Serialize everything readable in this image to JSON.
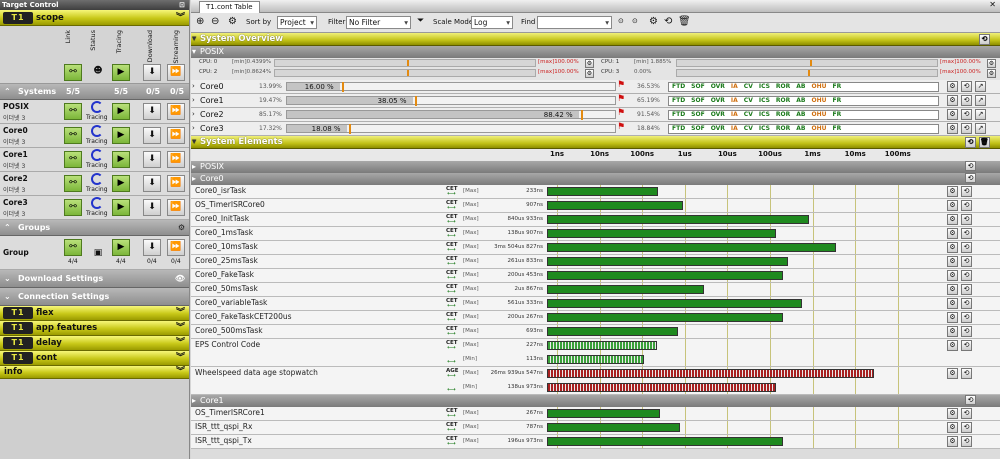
{
  "left": {
    "title": "Target Control",
    "scope_label": "scope",
    "logo_text": "T1",
    "col_headers": [
      "Link",
      "Status",
      "Tracing",
      "Download",
      "Streaming"
    ],
    "systems": {
      "label": "Systems",
      "c1": "5/5",
      "c2": "5/5",
      "c3": "0/5",
      "c4": "0/5"
    },
    "rows": [
      {
        "name": "POSIX",
        "sub": "이더넷 3",
        "status": "Tracing"
      },
      {
        "name": "Core0",
        "sub": "이더넷 3",
        "status": "Tracing"
      },
      {
        "name": "Core1",
        "sub": "이더넷 3",
        "status": "Tracing"
      },
      {
        "name": "Core2",
        "sub": "이더넷 3",
        "status": "Tracing"
      },
      {
        "name": "Core3",
        "sub": "이더넷 3",
        "status": "Tracing"
      }
    ],
    "groups": {
      "label": "Groups",
      "row": "Group",
      "c1": "4/4",
      "c2": "4/4",
      "c3": "0/4",
      "c4": "0/4"
    },
    "download_settings": "Download Settings",
    "connection_settings": "Connection Settings",
    "plugins": [
      "flex",
      "app features",
      "delay",
      "cont"
    ],
    "info": "info"
  },
  "right": {
    "tab": "T1.cont Table",
    "toolbar": {
      "sort_label": "Sort by",
      "sort_value": "Project",
      "filter_label": "Filter",
      "filter_value": "No Filter",
      "scale_label": "Scale Mode",
      "scale_value": "Log",
      "find_label": "Find"
    },
    "system_overview": "System Overview",
    "posix": "POSIX",
    "cpu": [
      {
        "label": "CPU: 0",
        "min": "[min]0.4399%",
        "max": "[max]100.00%",
        "fill": 0.43
      },
      {
        "label": "CPU: 1",
        "min": "[min] 1.885%",
        "max": "[max]100.00%",
        "fill": 1.88
      },
      {
        "label": "CPU: 2",
        "min": "[min]0.8624%",
        "max": "[max]100.00%",
        "fill": 0.86
      },
      {
        "label": "CPU: 3",
        "min": "0.00%",
        "max": "[max]100.00%",
        "fill": 0
      }
    ],
    "cores": [
      {
        "name": "Core0",
        "pct": "13.99%",
        "bar": "16.00 %",
        "right": "36.53%",
        "fill": 16.0
      },
      {
        "name": "Core1",
        "pct": "19.47%",
        "bar": "38.05 %",
        "right": "65.19%",
        "fill": 38.05
      },
      {
        "name": "Core2",
        "pct": "85.17%",
        "bar": "88.42 %",
        "right": "91.54%",
        "fill": 88.42
      },
      {
        "name": "Core3",
        "pct": "17.32%",
        "bar": "18.08 %",
        "right": "18.84%",
        "fill": 18.08
      }
    ],
    "flags": [
      "FTD",
      "SOF",
      "OVR",
      "IA",
      "CV",
      "ICS",
      "ROR",
      "AB",
      "OHU",
      "FR"
    ],
    "system_elements": "System Elements",
    "scale": [
      "1ns",
      "10ns",
      "100ns",
      "1us",
      "10us",
      "100us",
      "1ms",
      "10ms",
      "100ms"
    ],
    "posix_group": "POSIX",
    "core0_group": "Core0",
    "core1_group": "Core1",
    "elements": [
      {
        "name": "Core0_isrTask",
        "tag": "CET",
        "mm": "[Max]",
        "val": "233ns",
        "v": 2.33e-07,
        "color": "#1f8a1f"
      },
      {
        "name": "OS_TimerISRCore0",
        "tag": "CET",
        "mm": "[Max]",
        "val": "907ns",
        "v": 9.07e-07,
        "color": "#1f8a1f"
      },
      {
        "name": "Core0_InitTask",
        "tag": "CET",
        "mm": "[Max]",
        "val": "840us 933ns",
        "v": 0.0008409,
        "color": "#1f8a1f"
      },
      {
        "name": "Core0_1msTask",
        "tag": "CET",
        "mm": "[Max]",
        "val": "138us 907ns",
        "v": 0.0001389,
        "color": "#1f8a1f"
      },
      {
        "name": "Core0_10msTask",
        "tag": "CET",
        "mm": "[Max]",
        "val": "3ms 504us 827ns",
        "v": 0.003504,
        "color": "#1f8a1f"
      },
      {
        "name": "Core0_25msTask",
        "tag": "CET",
        "mm": "[Max]",
        "val": "261us 833ns",
        "v": 0.0002618,
        "color": "#1f8a1f"
      },
      {
        "name": "Core0_FakeTask",
        "tag": "CET",
        "mm": "[Max]",
        "val": "200us 453ns",
        "v": 0.0002004,
        "color": "#1f8a1f"
      },
      {
        "name": "Core0_50msTask",
        "tag": "CET",
        "mm": "[Max]",
        "val": "2us 867ns",
        "v": 2.867e-06,
        "color": "#1f8a1f"
      },
      {
        "name": "Core0_variableTask",
        "tag": "CET",
        "mm": "[Max]",
        "val": "561us 333ns",
        "v": 0.0005613,
        "color": "#1f8a1f"
      },
      {
        "name": "Core0_FakeTaskCET200us",
        "tag": "CET",
        "mm": "[Max]",
        "val": "200us 267ns",
        "v": 0.0002002,
        "color": "#1f8a1f"
      },
      {
        "name": "Core0_500msTask",
        "tag": "CET",
        "mm": "[Max]",
        "val": "693ns",
        "v": 6.93e-07,
        "color": "#1f8a1f"
      }
    ],
    "eps": {
      "name": "EPS Control Code",
      "tag": "CET",
      "rows": [
        {
          "mm": "[Max]",
          "val": "227ns",
          "v": 2.27e-07
        },
        {
          "mm": "[Min]",
          "val": "113ns",
          "v": 1.13e-07
        }
      ],
      "color": "#3aa03a"
    },
    "wheel": {
      "name": "Wheelspeed data age stopwatch",
      "tag": "AGE",
      "rows": [
        {
          "mm": "[Max]",
          "val": "26ms 939us 547ns",
          "v": 0.02694
        },
        {
          "mm": "[Min]",
          "val": "138us 973ns",
          "v": 0.00013897
        }
      ],
      "color": "#a82020"
    },
    "core1_elements": [
      {
        "name": "OS_TimerISRCore1",
        "tag": "CET",
        "mm": "[Max]",
        "val": "267ns",
        "v": 2.67e-07,
        "color": "#1f8a1f"
      },
      {
        "name": "ISR_ttt_qspi_Rx",
        "tag": "CET",
        "mm": "[Max]",
        "val": "787ns",
        "v": 7.87e-07,
        "color": "#1f8a1f"
      },
      {
        "name": "ISR_ttt_qspi_Tx",
        "tag": "CET",
        "mm": "[Max]",
        "val": "196us 973ns",
        "v": 0.00019697,
        "color": "#1f8a1f"
      }
    ]
  }
}
